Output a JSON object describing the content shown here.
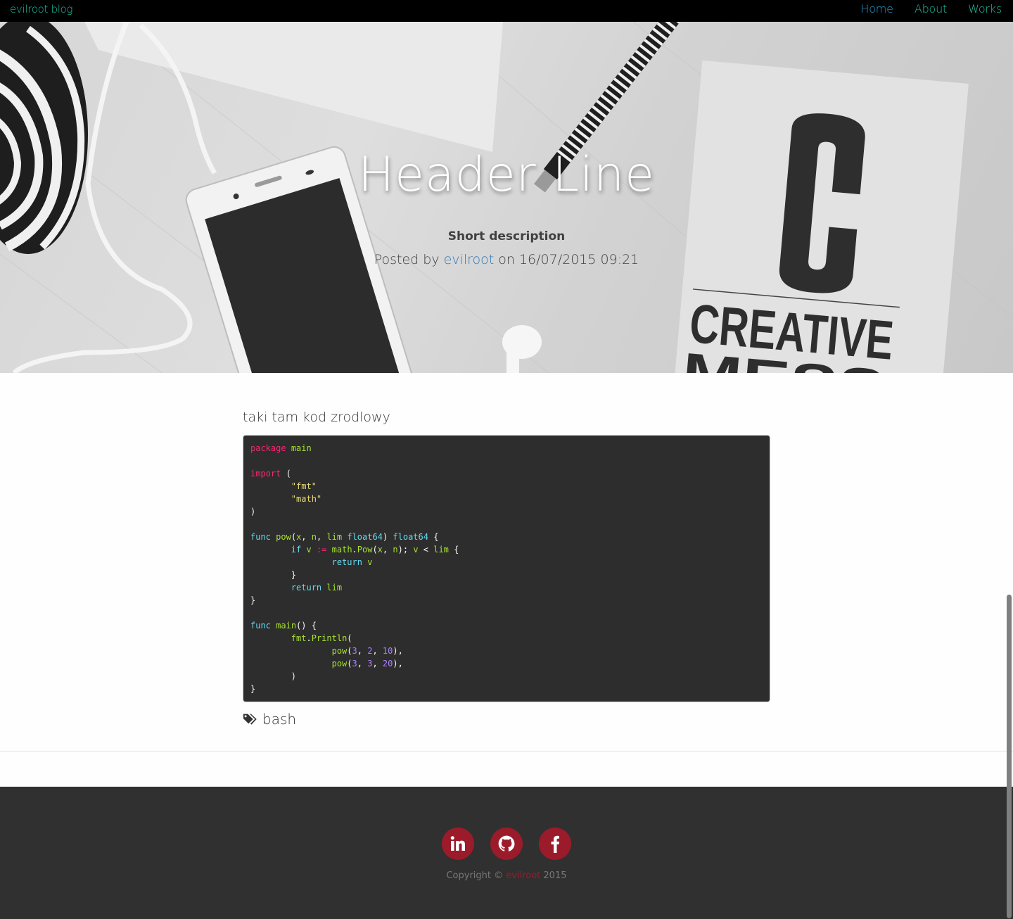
{
  "navbar": {
    "brand": "evilroot blog",
    "links": [
      {
        "label": "Home",
        "color": "#2a9fd6"
      },
      {
        "label": "About",
        "color": "#1fbf9f"
      },
      {
        "label": "Works",
        "color": "#1fbf9f"
      }
    ]
  },
  "hero": {
    "title": "Header Line",
    "subtitle": "Short description",
    "meta": {
      "prefix": "Posted by",
      "author": "evilroot",
      "on": "on",
      "datetime": "16/07/2015 09:21"
    },
    "image_text": {
      "letter": "C",
      "line1": "CREATIVE",
      "line2": "MESS"
    }
  },
  "post": {
    "heading": "taki tam kod zrodlowy",
    "code_language": "go",
    "code_lines": [
      [
        {
          "t": "package",
          "c": "kw"
        },
        {
          "t": " "
        },
        {
          "t": "main",
          "c": "name"
        }
      ],
      [],
      [
        {
          "t": "import",
          "c": "kw"
        },
        {
          "t": " ("
        }
      ],
      [
        {
          "t": "        "
        },
        {
          "t": "\"fmt\"",
          "c": "str"
        }
      ],
      [
        {
          "t": "        "
        },
        {
          "t": "\"math\"",
          "c": "str"
        }
      ],
      [
        {
          "t": ")"
        }
      ],
      [],
      [
        {
          "t": "func",
          "c": "decl"
        },
        {
          "t": " "
        },
        {
          "t": "pow",
          "c": "name"
        },
        {
          "t": "("
        },
        {
          "t": "x",
          "c": "name"
        },
        {
          "t": ", "
        },
        {
          "t": "n",
          "c": "name"
        },
        {
          "t": ", "
        },
        {
          "t": "lim",
          "c": "name"
        },
        {
          "t": " "
        },
        {
          "t": "float64",
          "c": "decl"
        },
        {
          "t": ") "
        },
        {
          "t": "float64",
          "c": "decl"
        },
        {
          "t": " {"
        }
      ],
      [
        {
          "t": "        "
        },
        {
          "t": "if",
          "c": "decl"
        },
        {
          "t": " "
        },
        {
          "t": "v",
          "c": "name"
        },
        {
          "t": " "
        },
        {
          "t": ":=",
          "c": "op"
        },
        {
          "t": " "
        },
        {
          "t": "math",
          "c": "name"
        },
        {
          "t": "."
        },
        {
          "t": "Pow",
          "c": "name"
        },
        {
          "t": "("
        },
        {
          "t": "x",
          "c": "name"
        },
        {
          "t": ", "
        },
        {
          "t": "n",
          "c": "name"
        },
        {
          "t": "); "
        },
        {
          "t": "v",
          "c": "name"
        },
        {
          "t": " < "
        },
        {
          "t": "lim",
          "c": "name"
        },
        {
          "t": " {"
        }
      ],
      [
        {
          "t": "                "
        },
        {
          "t": "return",
          "c": "decl"
        },
        {
          "t": " "
        },
        {
          "t": "v",
          "c": "name"
        }
      ],
      [
        {
          "t": "        }"
        }
      ],
      [
        {
          "t": "        "
        },
        {
          "t": "return",
          "c": "decl"
        },
        {
          "t": " "
        },
        {
          "t": "lim",
          "c": "name"
        }
      ],
      [
        {
          "t": "}"
        }
      ],
      [],
      [
        {
          "t": "func",
          "c": "decl"
        },
        {
          "t": " "
        },
        {
          "t": "main",
          "c": "name"
        },
        {
          "t": "() {"
        }
      ],
      [
        {
          "t": "        "
        },
        {
          "t": "fmt",
          "c": "name"
        },
        {
          "t": "."
        },
        {
          "t": "Println",
          "c": "name"
        },
        {
          "t": "("
        }
      ],
      [
        {
          "t": "                "
        },
        {
          "t": "pow",
          "c": "name"
        },
        {
          "t": "("
        },
        {
          "t": "3",
          "c": "num"
        },
        {
          "t": ", "
        },
        {
          "t": "2",
          "c": "num"
        },
        {
          "t": ", "
        },
        {
          "t": "10",
          "c": "num"
        },
        {
          "t": "),"
        }
      ],
      [
        {
          "t": "                "
        },
        {
          "t": "pow",
          "c": "name"
        },
        {
          "t": "("
        },
        {
          "t": "3",
          "c": "num"
        },
        {
          "t": ", "
        },
        {
          "t": "3",
          "c": "num"
        },
        {
          "t": ", "
        },
        {
          "t": "20",
          "c": "num"
        },
        {
          "t": "),"
        }
      ],
      [
        {
          "t": "        )"
        }
      ],
      [
        {
          "t": "}"
        }
      ]
    ],
    "tags": [
      "bash"
    ]
  },
  "footer": {
    "social": [
      {
        "name": "linkedin",
        "icon": "linkedin-icon"
      },
      {
        "name": "github",
        "icon": "github-icon"
      },
      {
        "name": "facebook",
        "icon": "facebook-icon"
      }
    ],
    "copyright_prefix": "Copyright ©",
    "copyright_owner": "evilroot",
    "copyright_year": "2015",
    "accent_color": "#9b1b2a"
  }
}
